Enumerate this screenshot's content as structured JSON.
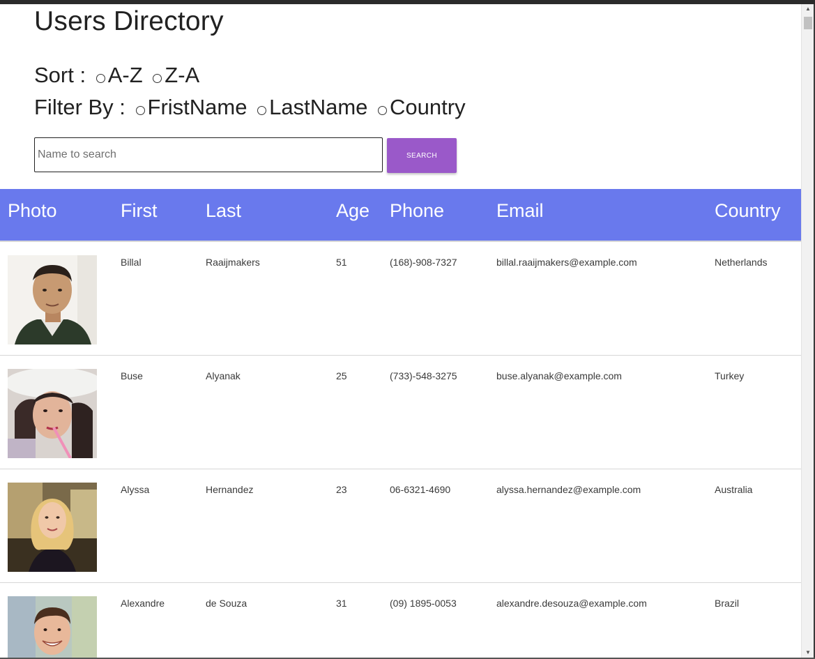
{
  "page": {
    "title": "Users Directory",
    "sort_label": "Sort :",
    "sort_options": [
      "A-Z",
      "Z-A"
    ],
    "filter_label": "Filter By :",
    "filter_options": [
      "FristName",
      "LastName",
      "Country"
    ]
  },
  "search": {
    "placeholder": "Name to search",
    "value": "",
    "button_label": "SEARCH"
  },
  "colors": {
    "header_bg": "#6979ed",
    "button_bg": "#9a59c9"
  },
  "table": {
    "columns": [
      "Photo",
      "First",
      "Last",
      "Age",
      "Phone",
      "Email",
      "Country"
    ],
    "rows": [
      {
        "first": "Billal",
        "last": "Raaijmakers",
        "age": "51",
        "phone": "(168)-908-7327",
        "email": "billal.raaijmakers@example.com",
        "country": "Netherlands",
        "photo": "portrait-man-white-background"
      },
      {
        "first": "Buse",
        "last": "Alyanak",
        "age": "25",
        "phone": "(733)-548-3275",
        "email": "buse.alyanak@example.com",
        "country": "Turkey",
        "photo": "portrait-woman-white-hat"
      },
      {
        "first": "Alyssa",
        "last": "Hernandez",
        "age": "23",
        "phone": "06-6321-4690",
        "email": "alyssa.hernandez@example.com",
        "country": "Australia",
        "photo": "portrait-woman-blonde"
      },
      {
        "first": "Alexandre",
        "last": "de Souza",
        "age": "31",
        "phone": "(09) 1895-0053",
        "email": "alexandre.desouza@example.com",
        "country": "Brazil",
        "photo": "portrait-man-smiling"
      }
    ]
  }
}
